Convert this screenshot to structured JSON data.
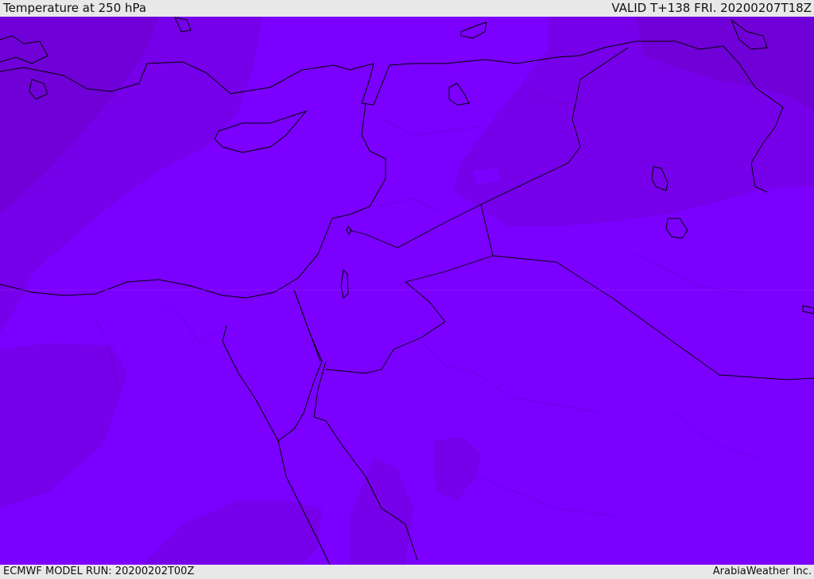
{
  "header": {
    "title": "Temperature at 250 hPa",
    "valid_label": "VALID T+138 FRI. 20200207T18Z"
  },
  "footer": {
    "model_run": "ECMWF MODEL RUN: 20200202T00Z",
    "credit": "ArabiaWeather Inc."
  },
  "map": {
    "colors": {
      "base": "#7b00ff",
      "mid": "#7600ea",
      "dark": "#7000d8",
      "darkest": "#6b00c8",
      "coast": "#000000"
    }
  }
}
